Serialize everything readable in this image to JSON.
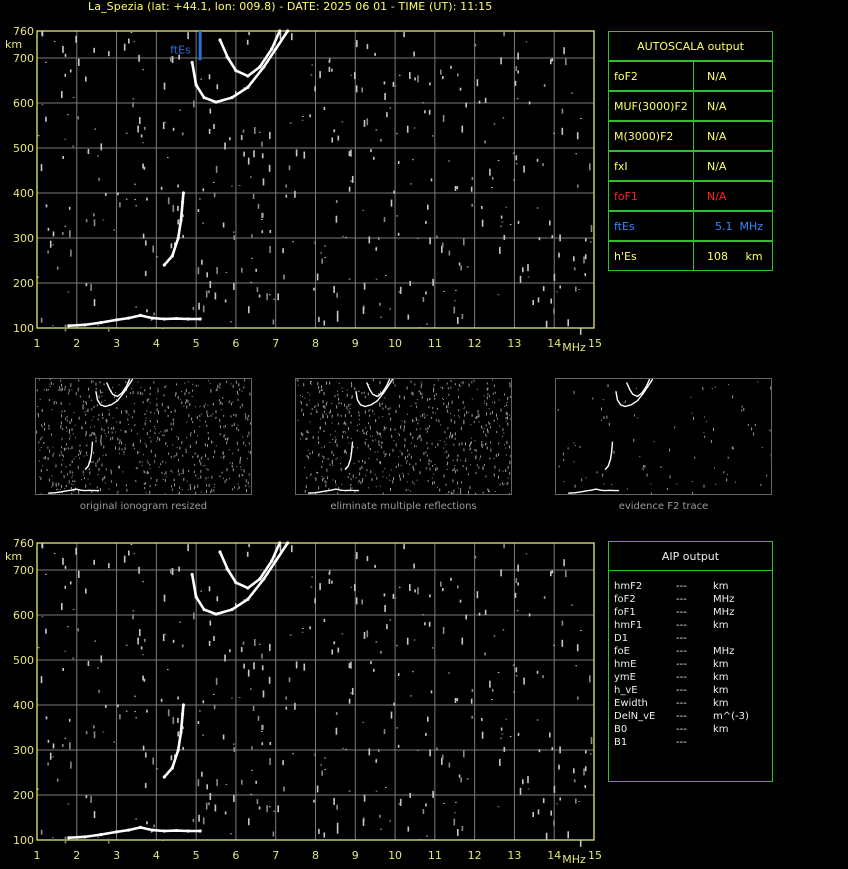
{
  "title": "La_Spezia (lat: +44.1, lon: 009.8) - DATE: 2025 06 01 - TIME (UT): 11:15",
  "ionogram": {
    "y_unit": "km",
    "x_unit": "MHz",
    "y_ticks": [
      "760",
      "700",
      "600",
      "500",
      "400",
      "300",
      "200",
      "100"
    ],
    "x_ticks": [
      "1",
      "2",
      "3",
      "4",
      "5",
      "6",
      "7",
      "8",
      "9",
      "10",
      "11",
      "12",
      "13",
      "14",
      "15"
    ],
    "fte_label": "ftEs",
    "colors": {
      "axis": "#e6e67a",
      "grid": "#7a7a7a",
      "trace": "#ffffff",
      "fte": "#2a6fd6"
    }
  },
  "autoscala": {
    "title": "AUTOSCALA output",
    "rows": [
      {
        "key": "foF2",
        "value": "N/A",
        "color": "#ffff66"
      },
      {
        "key": "MUF(3000)F2",
        "value": "N/A",
        "color": "#ffff66"
      },
      {
        "key": "M(3000)F2",
        "value": "N/A",
        "color": "#ffff66"
      },
      {
        "key": "fxI",
        "value": "N/A",
        "color": "#ffff66"
      },
      {
        "key": "foF1",
        "value": "N/A",
        "color": "#ff2020"
      },
      {
        "key": "ftEs",
        "value": "5.1  MHz",
        "color": "#3a86ff"
      },
      {
        "key": "h'Es",
        "value": "108     km",
        "color": "#ffff66"
      }
    ]
  },
  "thumbnails": [
    {
      "caption": "original ionogram resized"
    },
    {
      "caption": "eliminate multiple reflections"
    },
    {
      "caption": "evidence F2 trace"
    }
  ],
  "aip": {
    "title": "AIP output",
    "rows": [
      {
        "key": "hmF2",
        "dash": "---",
        "unit": "km"
      },
      {
        "key": "foF2",
        "dash": "---",
        "unit": "MHz"
      },
      {
        "key": "foF1",
        "dash": "---",
        "unit": "MHz"
      },
      {
        "key": "hmF1",
        "dash": "---",
        "unit": "km"
      },
      {
        "key": "D1",
        "dash": "---",
        "unit": ""
      },
      {
        "key": "foE",
        "dash": "---",
        "unit": "MHz"
      },
      {
        "key": "hmE",
        "dash": "---",
        "unit": "km"
      },
      {
        "key": "ymE",
        "dash": "---",
        "unit": "km"
      },
      {
        "key": "h_vE",
        "dash": "---",
        "unit": "km"
      },
      {
        "key": "Ewidth",
        "dash": "---",
        "unit": "km"
      },
      {
        "key": "DelN_vE",
        "dash": "---",
        "unit": "m^(-3)"
      },
      {
        "key": "B0",
        "dash": "---",
        "unit": "km"
      },
      {
        "key": "B1",
        "dash": "---",
        "unit": ""
      }
    ]
  },
  "chart_data": [
    {
      "type": "scatter",
      "title": "",
      "xlabel": "MHz",
      "ylabel": "km",
      "xlim": [
        1,
        15
      ],
      "ylim": [
        100,
        760
      ],
      "grid": true,
      "series": [
        {
          "values": [
            [
              1.8,
              105
            ],
            [
              2.2,
              107
            ],
            [
              2.6,
              112
            ],
            [
              3.0,
              118
            ],
            [
              3.3,
              122
            ],
            [
              3.6,
              128
            ],
            [
              3.9,
              122
            ],
            [
              4.2,
              120
            ],
            [
              4.5,
              121
            ],
            [
              4.8,
              120
            ],
            [
              5.1,
              120
            ]
          ]
        },
        {
          "values": [
            [
              4.2,
              240
            ],
            [
              4.4,
              260
            ],
            [
              4.55,
              300
            ],
            [
              4.62,
              340
            ],
            [
              4.66,
              380
            ],
            [
              4.68,
              400
            ]
          ]
        },
        {
          "values": [
            [
              4.9,
              690
            ],
            [
              5.0,
              640
            ],
            [
              5.2,
              612
            ],
            [
              5.5,
              602
            ],
            [
              5.9,
              612
            ],
            [
              6.3,
              635
            ],
            [
              6.7,
              680
            ],
            [
              7.0,
              720
            ],
            [
              7.3,
              760
            ]
          ]
        },
        {
          "values": [
            [
              5.6,
              740
            ],
            [
              5.8,
              700
            ],
            [
              6.0,
              672
            ],
            [
              6.3,
              660
            ],
            [
              6.6,
              680
            ],
            [
              6.9,
              720
            ],
            [
              7.1,
              760
            ]
          ]
        }
      ]
    },
    {
      "type": "scatter",
      "title": "",
      "xlabel": "MHz",
      "ylabel": "km",
      "xlim": [
        1,
        15
      ],
      "ylim": [
        100,
        760
      ],
      "grid": true,
      "series": [
        {
          "values": [
            [
              1.8,
              105
            ],
            [
              2.2,
              107
            ],
            [
              2.6,
              112
            ],
            [
              3.0,
              118
            ],
            [
              3.3,
              122
            ],
            [
              3.6,
              128
            ],
            [
              3.9,
              122
            ],
            [
              4.2,
              120
            ],
            [
              4.5,
              121
            ],
            [
              4.8,
              120
            ],
            [
              5.1,
              120
            ]
          ]
        },
        {
          "values": [
            [
              4.2,
              240
            ],
            [
              4.4,
              260
            ],
            [
              4.55,
              300
            ],
            [
              4.62,
              340
            ],
            [
              4.66,
              380
            ],
            [
              4.68,
              400
            ]
          ]
        },
        {
          "values": [
            [
              4.9,
              690
            ],
            [
              5.0,
              640
            ],
            [
              5.2,
              612
            ],
            [
              5.5,
              602
            ],
            [
              5.9,
              612
            ],
            [
              6.3,
              635
            ],
            [
              6.7,
              680
            ],
            [
              7.0,
              720
            ],
            [
              7.3,
              760
            ]
          ]
        },
        {
          "values": [
            [
              5.6,
              740
            ],
            [
              5.8,
              700
            ],
            [
              6.0,
              672
            ],
            [
              6.3,
              660
            ],
            [
              6.6,
              680
            ],
            [
              6.9,
              720
            ],
            [
              7.1,
              760
            ]
          ]
        }
      ]
    }
  ]
}
